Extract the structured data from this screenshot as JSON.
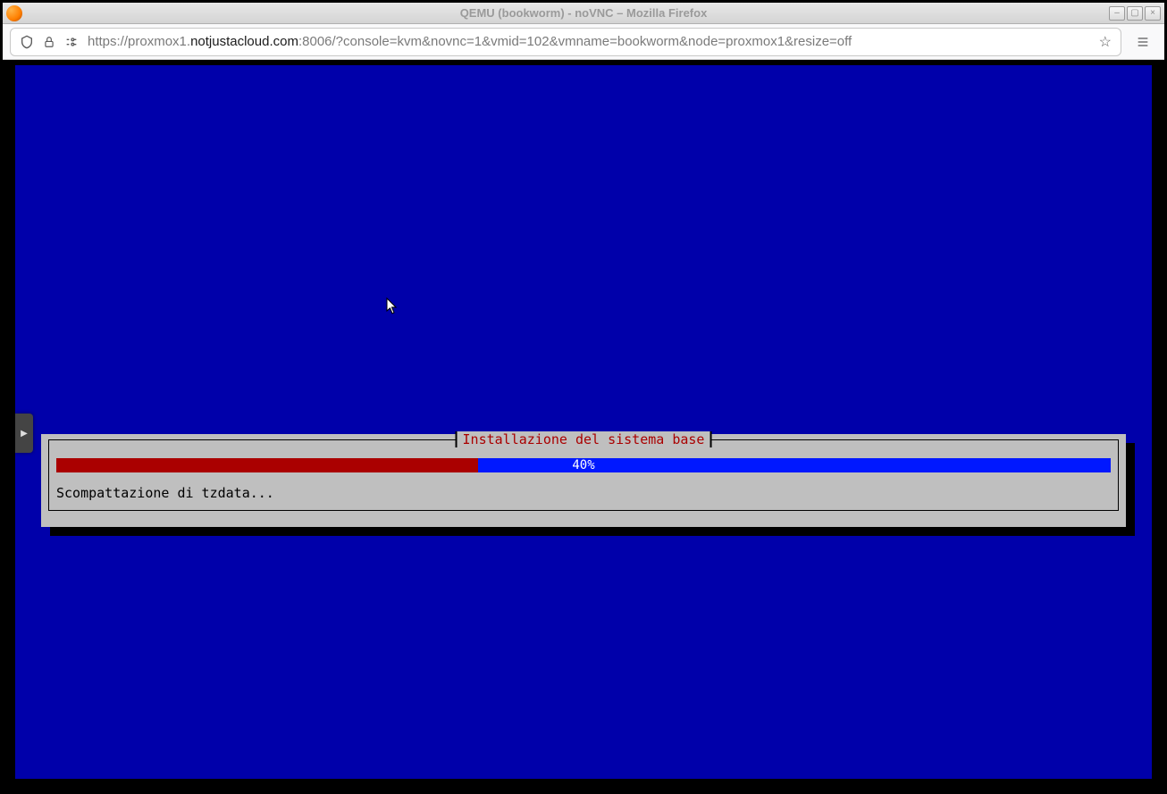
{
  "window": {
    "title": "QEMU (bookworm) - noVNC – Mozilla Firefox"
  },
  "toolbar": {
    "url_prefix": "https://proxmox1.",
    "url_host": "notjustacloud.com",
    "url_suffix": ":8006/?console=kvm&novnc=1&vmid=102&vmname=bookworm&node=proxmox1&resize=off"
  },
  "sidetab": {
    "glyph": "▶"
  },
  "installer": {
    "title": "Installazione del sistema base",
    "progress_percent": 40,
    "progress_label": "40%",
    "status": "Scompattazione di tzdata..."
  },
  "colors": {
    "installer_bg": "#0000aa",
    "dialog_bg": "#bfbfbf",
    "progress_fill": "#aa0000",
    "progress_track": "#0018ff",
    "title_red": "#aa0000"
  }
}
